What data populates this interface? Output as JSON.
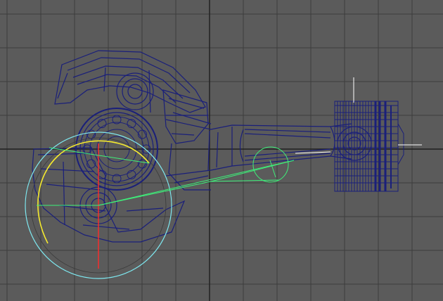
{
  "viewport": {
    "view": "top-viewport",
    "background_color": "#5b5b5b",
    "grid_color": "#3c3c3c",
    "grid_axis_color": "#1f1f1f",
    "grid_visible": true
  },
  "scene": {
    "wireframe_color": "#1a1f7a",
    "selection_color": "#2d3aa8",
    "gizmos": {
      "cyan_arc_color": "#7ee8f0",
      "yellow_arc_color": "#f5ea2e",
      "green_helper_color": "#3ef07a",
      "red_axis_color": "#ff2a2a",
      "white_axis_color": "#ffffff"
    },
    "objects": [
      {
        "name": "crankshaft-counterweight",
        "icon": "crankshaft-wireframe"
      },
      {
        "name": "main-bearing",
        "icon": "bearing-wireframe"
      },
      {
        "name": "connecting-rod",
        "icon": "rod-wireframe"
      },
      {
        "name": "piston",
        "icon": "piston-wireframe"
      }
    ]
  }
}
